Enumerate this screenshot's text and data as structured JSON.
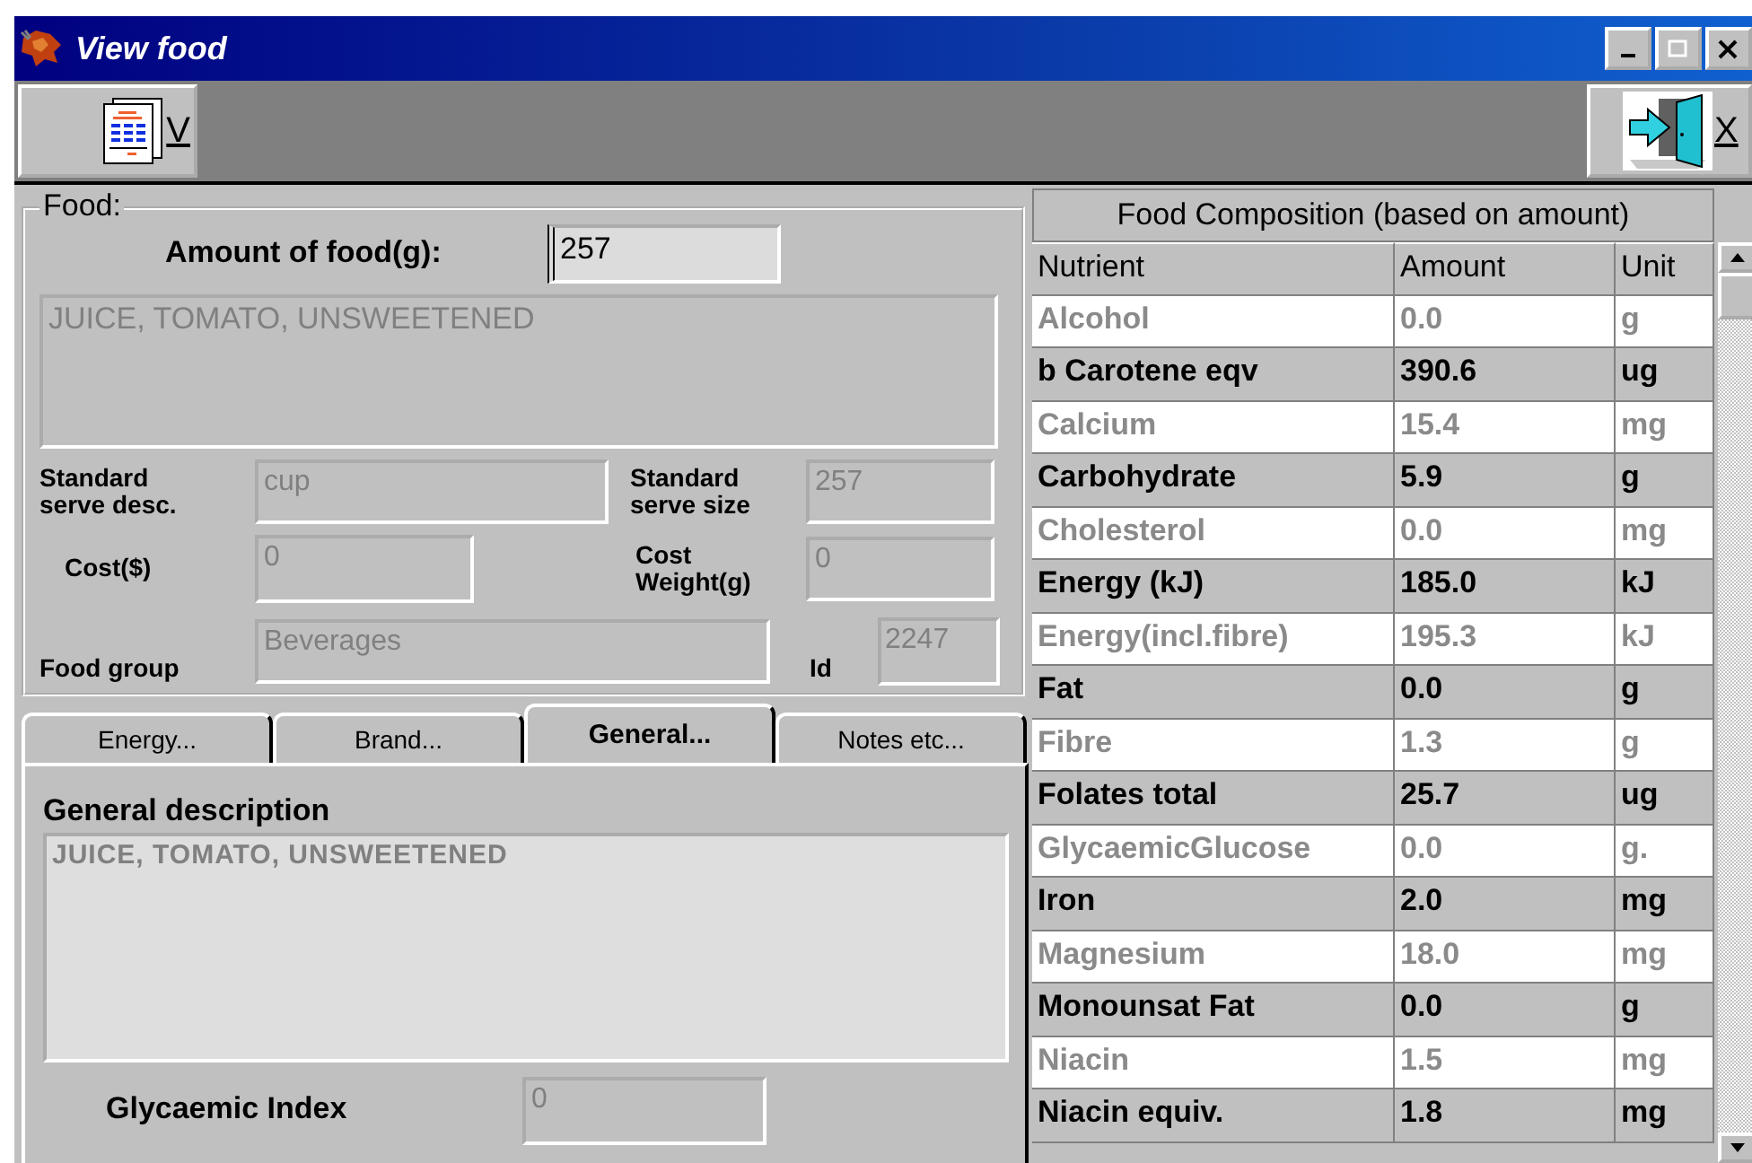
{
  "window": {
    "title": "View food"
  },
  "toolbar": {
    "buttons": [
      {
        "kind": "view",
        "label": "V"
      },
      {
        "kind": "exit",
        "label": "X"
      }
    ]
  },
  "food": {
    "legend": "Food:",
    "amount_label": "Amount of food(g):",
    "amount": "257",
    "description": "JUICE, TOMATO, UNSWEETENED",
    "serve_desc_label": "Standard serve desc.",
    "serve_desc": "cup",
    "serve_size_label": "Standard serve size",
    "serve_size": "257",
    "cost_label": "Cost($)",
    "cost": "0",
    "cost_weight_label": "Cost Weight(g)",
    "cost_weight": "0",
    "group_label": "Food group",
    "group": "Beverages",
    "id_label": "Id",
    "id": "2247"
  },
  "tabs": [
    {
      "label": "Energy...",
      "selected": false
    },
    {
      "label": "Brand...",
      "selected": false
    },
    {
      "label": "General...",
      "selected": true
    },
    {
      "label": "Notes etc...",
      "selected": false
    }
  ],
  "general": {
    "heading": "General description",
    "description": "JUICE, TOMATO, UNSWEETENED",
    "gi_label": "Glycaemic Index",
    "gi": "0"
  },
  "composition": {
    "caption": "Food Composition (based on amount)",
    "columns": [
      "Nutrient",
      "Amount",
      "Unit"
    ],
    "rows": [
      [
        "Alcohol",
        "0.0",
        "g"
      ],
      [
        "b Carotene eqv",
        "390.6",
        "ug"
      ],
      [
        "Calcium",
        "15.4",
        "mg"
      ],
      [
        "Carbohydrate",
        "5.9",
        "g"
      ],
      [
        "Cholesterol",
        "0.0",
        "mg"
      ],
      [
        "Energy (kJ)",
        "185.0",
        "kJ"
      ],
      [
        "Energy(incl.fibre)",
        "195.3",
        "kJ"
      ],
      [
        "Fat",
        "0.0",
        "g"
      ],
      [
        "Fibre",
        "1.3",
        "g"
      ],
      [
        "Folates total",
        "25.7",
        "ug"
      ],
      [
        "GlycaemicGlucose",
        "0.0",
        "g."
      ],
      [
        "Iron",
        "2.0",
        "mg"
      ],
      [
        "Magnesium",
        "18.0",
        "mg"
      ],
      [
        "Monounsat Fat",
        "0.0",
        "g"
      ],
      [
        "Niacin",
        "1.5",
        "mg"
      ],
      [
        "Niacin equiv.",
        "1.8",
        "mg"
      ]
    ]
  }
}
